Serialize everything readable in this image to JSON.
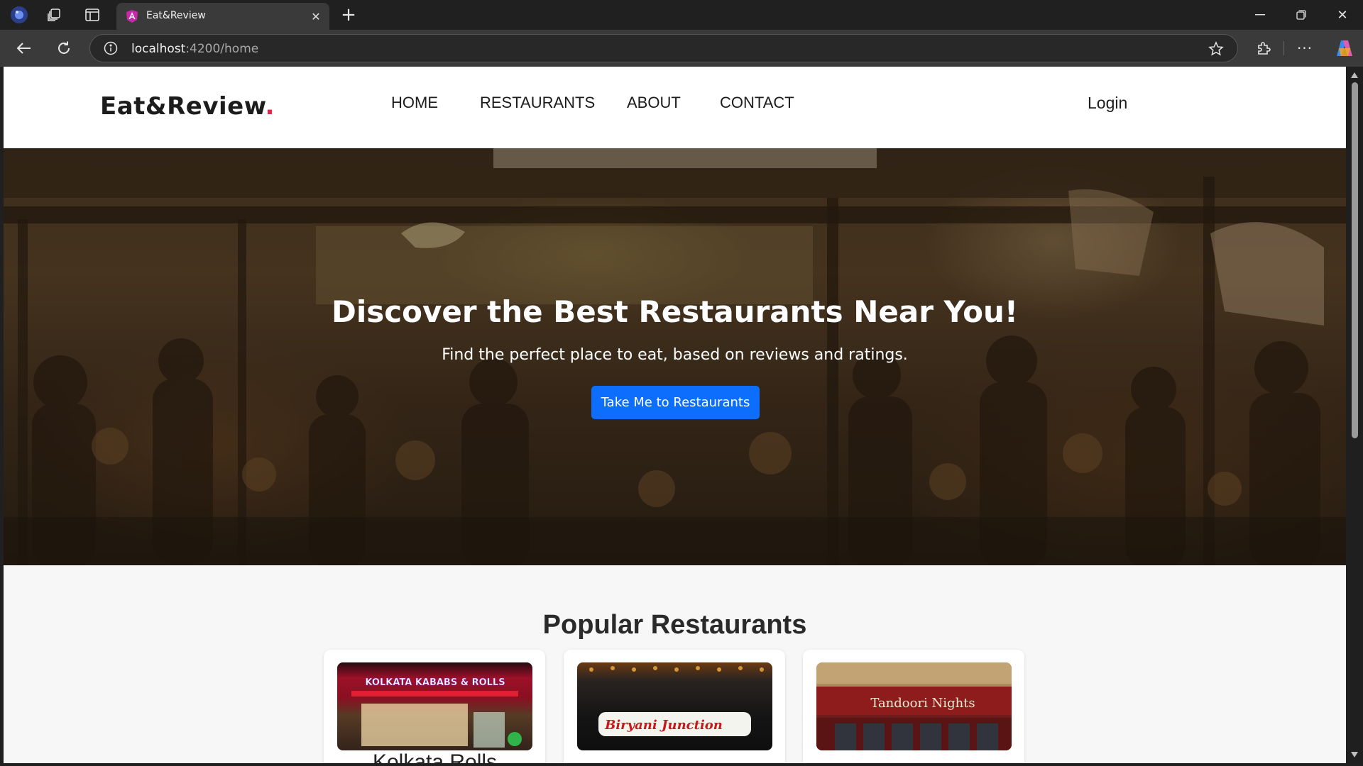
{
  "browser": {
    "tab_title": "Eat&Review",
    "url_host": "localhost",
    "url_path": ":4200/home",
    "icons": [
      "profile-icon",
      "workspaces-icon",
      "vertical-tabs-icon",
      "new-tab-icon",
      "minimize-icon",
      "restore-icon",
      "close-window-icon",
      "back-icon",
      "refresh-icon",
      "site-info-icon",
      "favorite-star-icon",
      "extensions-icon",
      "more-menu-icon",
      "copilot-icon"
    ]
  },
  "site": {
    "logo_text": "Eat&Review",
    "logo_dot": ".",
    "nav": {
      "home": "HOME",
      "restaurants": "RESTAURANTS",
      "about": "ABOUT",
      "contact": "CONTACT"
    },
    "login": "Login"
  },
  "hero": {
    "title": "Discover the Best Restaurants Near You!",
    "subtitle": "Find the perfect place to eat, based on reviews and ratings.",
    "cta": "Take Me to Restaurants"
  },
  "popular": {
    "title": "Popular Restaurants",
    "cards": [
      {
        "sign": "KOLKATA KABABS & ROLLS",
        "name": "Kolkata Rolls"
      },
      {
        "sign": "Biryani Junction",
        "name": ""
      },
      {
        "sign": "Tandoori Nights",
        "name": ""
      }
    ]
  },
  "colors": {
    "accent": "#0d6efd",
    "logo_dot": "#e8224b",
    "nav_bg": "#ffffff",
    "page_bg": "#f7f7f7"
  }
}
